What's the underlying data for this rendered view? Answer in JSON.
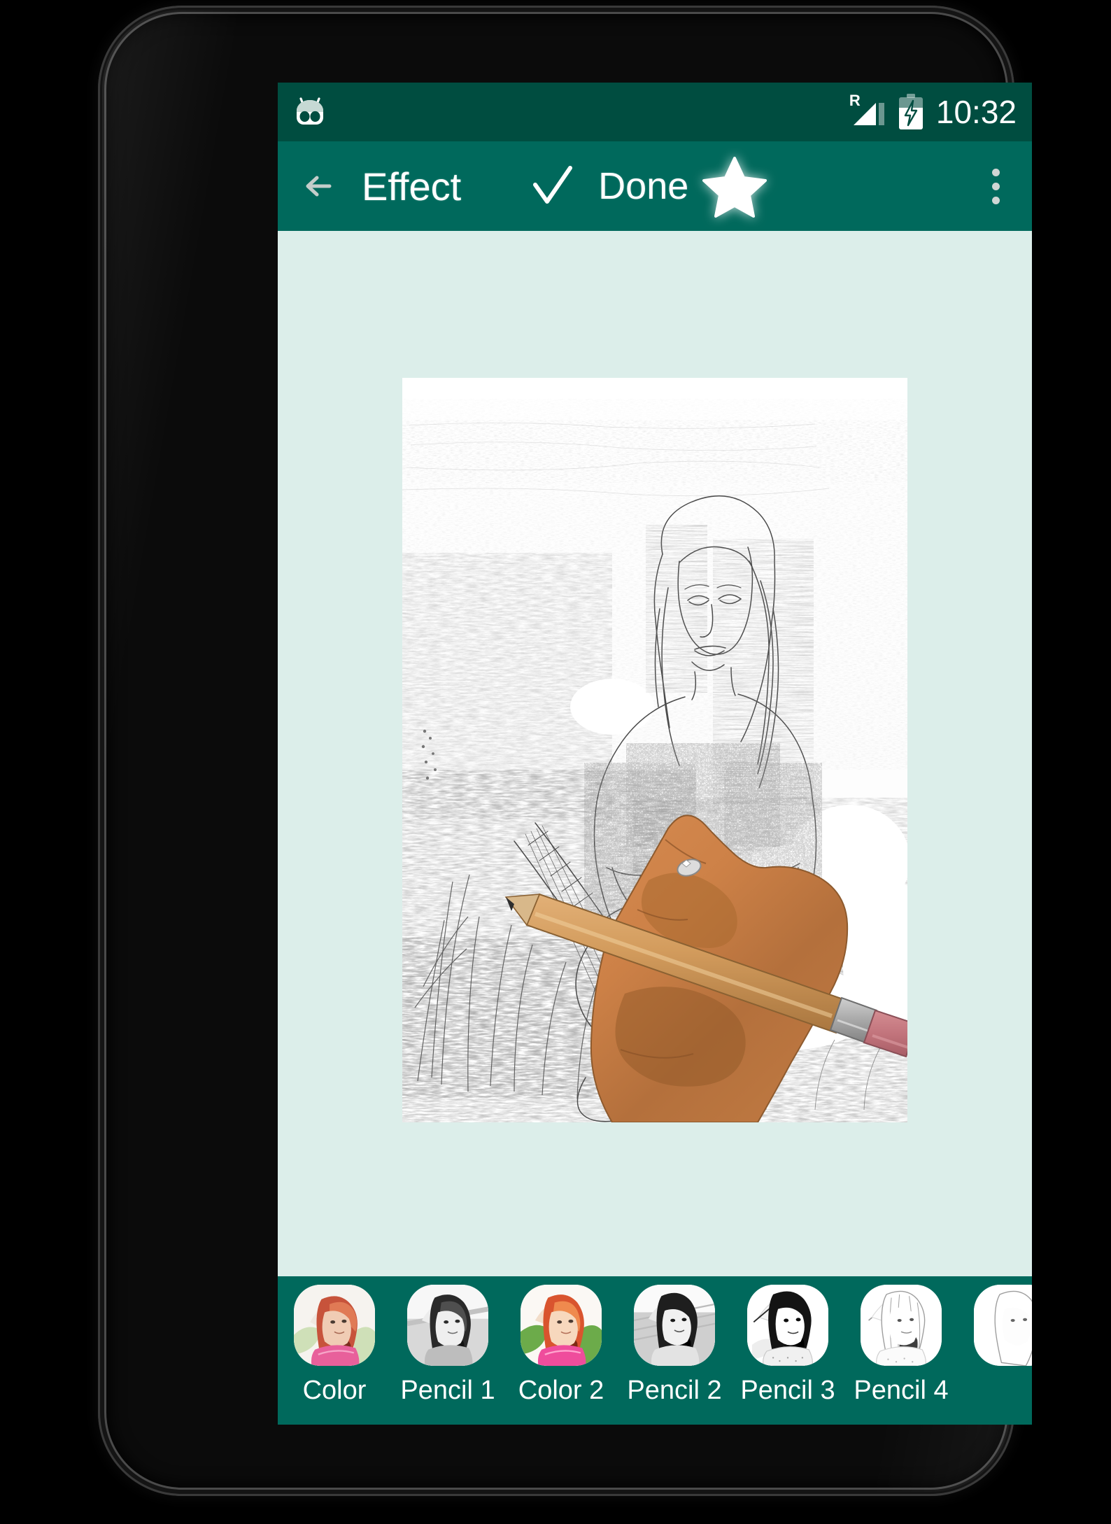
{
  "device": {
    "frame_color": "#0b0b0b",
    "screen_bg": "#dceeea"
  },
  "statusbar": {
    "background": "#004d40",
    "logo_icon": "cyanogenmod-logo-icon",
    "roaming_indicator": "R",
    "signal_icon": "signal-bars-icon",
    "battery_icon": "battery-charging-icon",
    "clock": "10:32"
  },
  "appbar": {
    "background": "#00695c",
    "back_icon": "arrow-left-icon",
    "title": "Effect",
    "check_icon": "checkmark-icon",
    "done_label": "Done",
    "star_icon": "star-icon",
    "overflow_icon": "more-vertical-icon"
  },
  "canvas": {
    "background": "#dceeea",
    "preview_alt": "pencil-sketch-effect-preview",
    "overlay_alt": "hand-holding-pencil-overlay"
  },
  "filters": {
    "background": "#00695c",
    "selected": "Color",
    "items": [
      {
        "label": "Color",
        "thumb": "thumb-color"
      },
      {
        "label": "Pencil 1",
        "thumb": "thumb-pencil-1"
      },
      {
        "label": "Color 2",
        "thumb": "thumb-color-2"
      },
      {
        "label": "Pencil 2",
        "thumb": "thumb-pencil-2"
      },
      {
        "label": "Pencil 3",
        "thumb": "thumb-pencil-3"
      },
      {
        "label": "Pencil 4",
        "thumb": "thumb-pencil-4"
      },
      {
        "label": "",
        "thumb": "thumb-pencil-5-partial"
      }
    ]
  }
}
